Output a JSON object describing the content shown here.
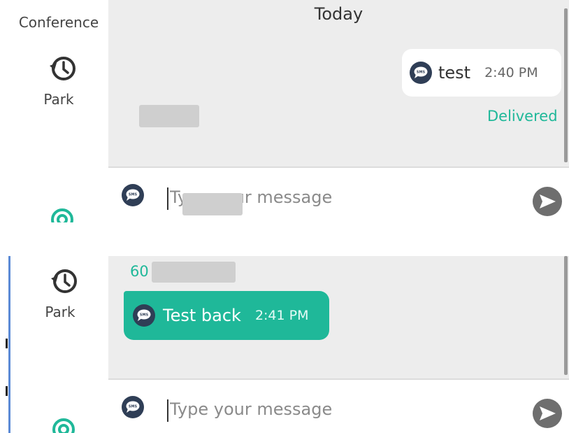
{
  "top": {
    "sidebar": {
      "conference_label": "Conference",
      "park_label": "Park"
    },
    "date_separator": "Today",
    "outgoing": {
      "text": "test",
      "time": "2:40 PM",
      "status": "Delivered"
    },
    "composer": {
      "placeholder": "Type your message"
    }
  },
  "bottom": {
    "sidebar": {
      "park_label": "Park"
    },
    "sender_partial": "60",
    "incoming": {
      "text": "Test back",
      "time": "2:41 PM"
    },
    "composer": {
      "placeholder": "Type your message"
    }
  },
  "icons": {
    "park": "clock-history-icon",
    "sms": "sms-bubble-icon",
    "send": "send-arrow-icon",
    "status_partial": "green-ring-icon"
  },
  "colors": {
    "accent": "#1fb899",
    "conversation_bg": "#ededed",
    "sms_icon_bg": "#2f3e56",
    "send_icon": "#6e6e6e"
  }
}
